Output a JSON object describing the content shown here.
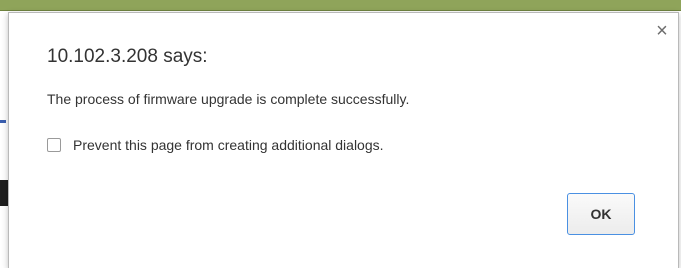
{
  "dialog": {
    "title": "10.102.3.208 says:",
    "message": "The process of firmware upgrade is complete successfully.",
    "checkbox_label": "Prevent this page from creating additional dialogs.",
    "checkbox_checked": false,
    "ok_label": "OK",
    "close_glyph": "×"
  },
  "icons": {
    "close": "close-icon"
  },
  "colors": {
    "ok_border": "#4a90e2",
    "page_strip": "#8fa45a"
  }
}
